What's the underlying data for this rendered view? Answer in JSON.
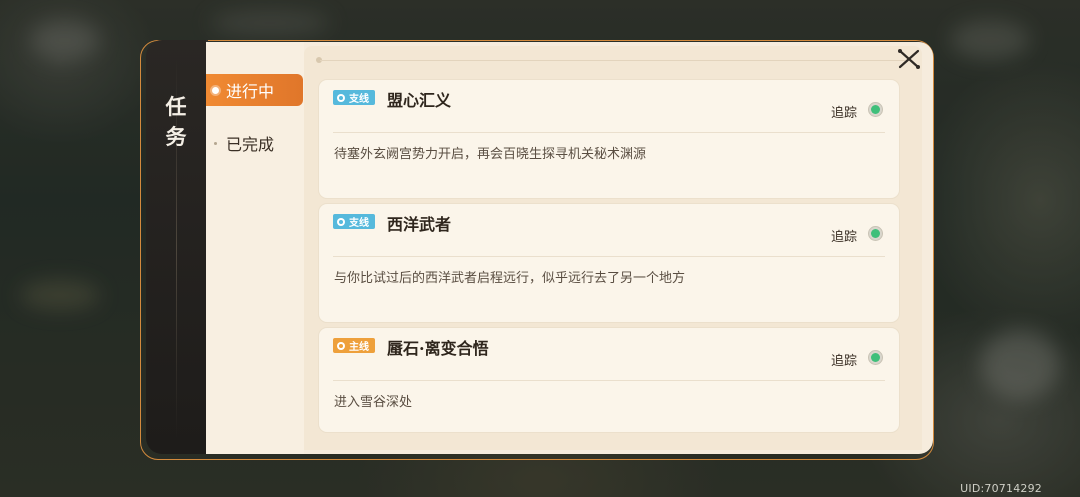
{
  "panel": {
    "title_chars": [
      "任",
      "务"
    ]
  },
  "tabs": [
    {
      "label": "进行中",
      "active": true
    },
    {
      "label": "已完成",
      "active": false
    }
  ],
  "quests": [
    {
      "type": "支线",
      "name": "盟心汇义",
      "track_label": "追踪",
      "description": "待塞外玄阙宫势力开启，再会百晓生探寻机关秘术渊源"
    },
    {
      "type": "支线",
      "name": "西洋武者",
      "track_label": "追踪",
      "description": "与你比试过后的西洋武者启程远行，似乎远行去了另一个地方"
    },
    {
      "type": "主线",
      "name": "蜃石·离变合悟",
      "track_label": "追踪",
      "description": "进入雪谷深处"
    }
  ],
  "footer": {
    "uid": "UID:70714292"
  },
  "colors": {
    "accent": "#e0762a",
    "side_badge": "#56b9dc",
    "main_badge": "#eea03b",
    "track_dot": "#3fbf7a"
  }
}
